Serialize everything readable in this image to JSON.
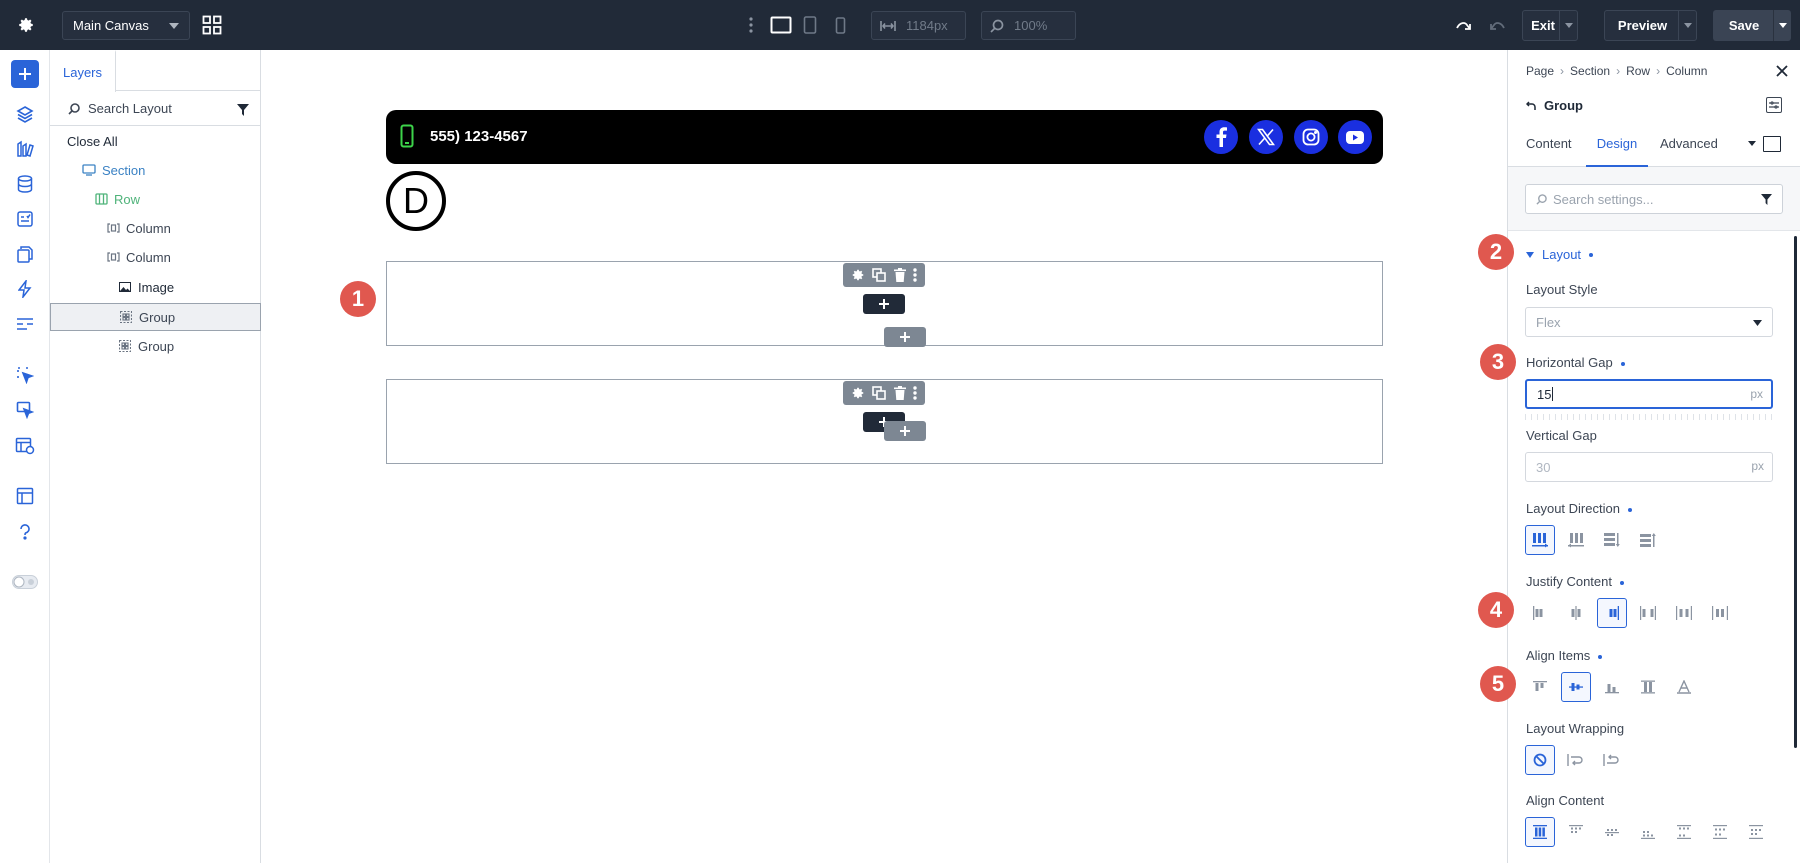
{
  "topbar": {
    "canvas_select": "Main Canvas",
    "width_value": "1184px",
    "zoom_value": "100%",
    "exit_label": "Exit",
    "preview_label": "Preview",
    "save_label": "Save"
  },
  "layers": {
    "tab_label": "Layers",
    "search_placeholder": "Search Layout",
    "close_all": "Close All",
    "items": [
      {
        "label": "Section",
        "type": "section",
        "color": "#3b82c4"
      },
      {
        "label": "Row",
        "type": "row",
        "color": "#4fb37a"
      },
      {
        "label": "Column",
        "type": "column",
        "color": "#3d4654"
      },
      {
        "label": "Column",
        "type": "column",
        "color": "#3d4654"
      },
      {
        "label": "Image",
        "type": "image",
        "color": "#1f2937"
      },
      {
        "label": "Group",
        "type": "group",
        "color": "#3d4654",
        "selected": true
      },
      {
        "label": "Group",
        "type": "group",
        "color": "#3d4654"
      }
    ]
  },
  "canvas": {
    "phone": "555) 123-4567",
    "logo_letter": "D",
    "social_icons": [
      "facebook-icon",
      "x-icon",
      "instagram-icon",
      "youtube-icon"
    ],
    "accent": "#1a2fe0",
    "badges": [
      "1",
      "2",
      "3",
      "4",
      "5"
    ]
  },
  "props": {
    "breadcrumb": [
      "Page",
      "Section",
      "Row",
      "Column"
    ],
    "title": "Group",
    "tabs": [
      "Content",
      "Design",
      "Advanced"
    ],
    "active_tab": "Design",
    "search_placeholder": "Search settings...",
    "layout_section": "Layout",
    "layout_style_label": "Layout Style",
    "layout_style_value": "Flex",
    "hgap_label": "Horizontal Gap",
    "hgap_value": "15",
    "hgap_unit": "px",
    "vgap_label": "Vertical Gap",
    "vgap_placeholder": "30",
    "vgap_unit": "px",
    "direction_label": "Layout Direction",
    "justify_label": "Justify Content",
    "align_items_label": "Align Items",
    "wrap_label": "Layout Wrapping",
    "align_content_label": "Align Content"
  },
  "colors": {
    "topbar_bg": "#212a38",
    "primary": "#2a64d8",
    "badge": "#e0584f",
    "save_bg": "#3a4454"
  }
}
